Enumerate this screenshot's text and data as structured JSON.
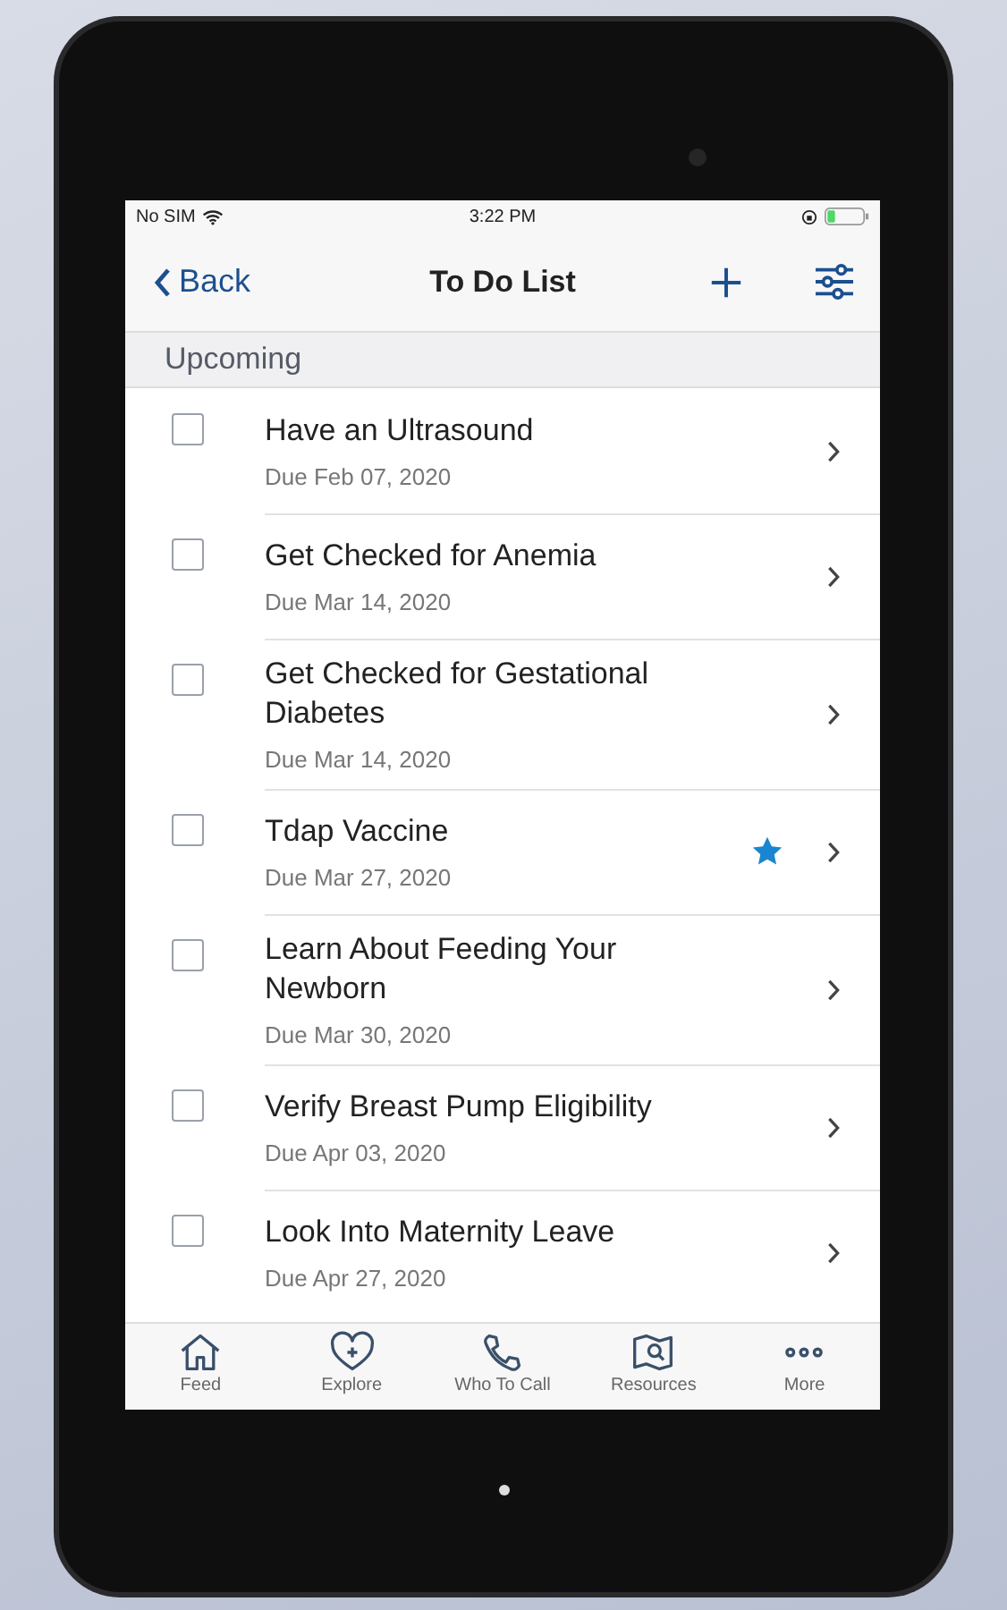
{
  "status_bar": {
    "carrier": "No SIM",
    "time": "3:22 PM"
  },
  "nav": {
    "back": "Back",
    "title": "To Do List"
  },
  "section": {
    "title": "Upcoming"
  },
  "tasks": [
    {
      "title": "Have an Ultrasound",
      "due": "Due Feb 07, 2020",
      "checked": false,
      "starred": false
    },
    {
      "title": "Get Checked for Anemia",
      "due": "Due Mar 14, 2020",
      "checked": false,
      "starred": false
    },
    {
      "title": "Get Checked for Gestational Diabetes",
      "due": "Due Mar 14, 2020",
      "checked": false,
      "starred": false
    },
    {
      "title": "Tdap Vaccine",
      "due": "Due Mar 27, 2020",
      "checked": false,
      "starred": true
    },
    {
      "title": "Learn About Feeding Your Newborn",
      "due": "Due Mar 30, 2020",
      "checked": false,
      "starred": false
    },
    {
      "title": "Verify Breast Pump Eligibility",
      "due": "Due Apr 03, 2020",
      "checked": false,
      "starred": false
    },
    {
      "title": "Look Into Maternity Leave",
      "due": "Due Apr 27, 2020",
      "checked": false,
      "starred": false
    }
  ],
  "tab_bar": [
    {
      "kind": "home",
      "label": "Feed"
    },
    {
      "kind": "heart",
      "label": "Explore"
    },
    {
      "kind": "phone",
      "label": "Who To Call"
    },
    {
      "kind": "map",
      "label": "Resources"
    },
    {
      "kind": "more",
      "label": "More"
    }
  ]
}
